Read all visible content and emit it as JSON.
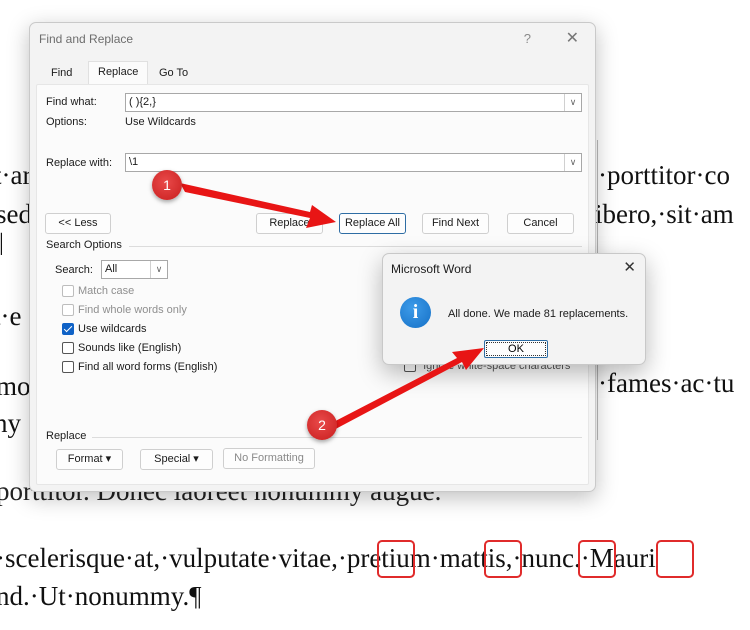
{
  "document": {
    "left_lines": [
      {
        "text": "t·ar"
      },
      {
        "text": "sed"
      },
      {
        "text": "t·e"
      },
      {
        "text": "mo"
      },
      {
        "text": "ny"
      }
    ],
    "right_lines": [
      {
        "text": "·porttitor·co"
      },
      {
        "text": "ibero,·sit·am"
      },
      {
        "text": "·fames·ac·tu"
      }
    ],
    "line_below_dialog": "porttitor. Donec laoreet nonummy augue.",
    "line_3": "·scelerisque·at,·vulputate·vitae,·pretium·mattis,·nunc.·Mauri",
    "line_4": "nd.·Ut·nonummy.¶"
  },
  "find_replace": {
    "title": "Find and Replace",
    "help_label": "?",
    "close_label": "✕",
    "tabs": [
      {
        "label": "Find",
        "active": false
      },
      {
        "label": "Replace",
        "active": true
      },
      {
        "label": "Go To",
        "active": false
      }
    ],
    "find_what_label": "Find what:",
    "find_what_value": "( ){2,}",
    "options_label": "Options:",
    "options_value": "Use Wildcards",
    "replace_with_label": "Replace with:",
    "replace_with_value": "\\1",
    "buttons": {
      "less": "<< Less",
      "replace": "Replace",
      "replace_all": "Replace All",
      "find_next": "Find Next",
      "cancel": "Cancel"
    },
    "search_options_header": "Search Options",
    "search_label": "Search:",
    "search_value": "All",
    "checkboxes": [
      {
        "label": "Match case",
        "checked": false,
        "disabled": true
      },
      {
        "label": "Find whole words only",
        "checked": false,
        "disabled": true
      },
      {
        "label": "Use wildcards",
        "checked": true,
        "disabled": false
      },
      {
        "label": "Sounds like (English)",
        "checked": false,
        "disabled": false
      },
      {
        "label": "Find all word forms (English)",
        "checked": false,
        "disabled": false
      }
    ],
    "partially_hidden_option": "Ignore white-space characters",
    "replace_header": "Replace",
    "format_button": "Format ▾",
    "special_button": "Special ▾",
    "no_formatting_button": "No Formatting"
  },
  "message_box": {
    "title": "Microsoft Word",
    "close_label": "✕",
    "icon": "info-icon",
    "icon_glyph": "i",
    "message": "All done. We made 81 replacements.",
    "ok_label": "OK"
  },
  "annotations": {
    "badges": [
      {
        "label": "1"
      },
      {
        "label": "2"
      }
    ],
    "arrow_color": "#e81515",
    "highlight_color": "#e02b2b"
  }
}
